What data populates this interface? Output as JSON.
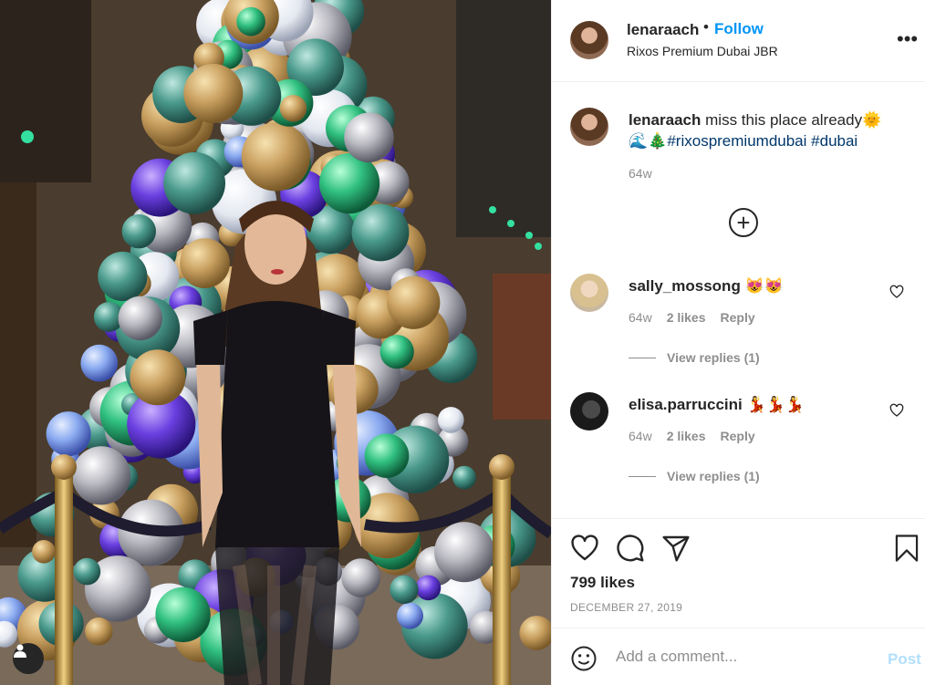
{
  "post": {
    "username": "lenaraach",
    "follow_label": "Follow",
    "location": "Rixos Premium Dubai JBR",
    "more_icon": "more-options-icon",
    "caption": {
      "username": "lenaraach",
      "text": "miss this place already🌞",
      "line2_emoji": "🌊🎄",
      "hashtag1": "#rixospremiumdubai",
      "hashtag2": "#dubai",
      "time": "64w"
    },
    "comments": [
      {
        "username": "sally_mossong",
        "text": "😻😻",
        "time": "64w",
        "likes": "2 likes",
        "reply": "Reply",
        "view_replies": "View replies (1)"
      },
      {
        "username": "elisa.parruccini",
        "text": "💃💃💃",
        "time": "64w",
        "likes": "2 likes",
        "reply": "Reply",
        "view_replies": "View replies (1)"
      }
    ],
    "likes": "799 likes",
    "date": "DECEMBER 27, 2019",
    "comment_placeholder": "Add a comment...",
    "post_label": "Post",
    "colors": {
      "link": "#0095f6",
      "hashtag": "#00376b",
      "muted": "#8e8e8e",
      "post_disabled": "#b2dffc"
    }
  }
}
